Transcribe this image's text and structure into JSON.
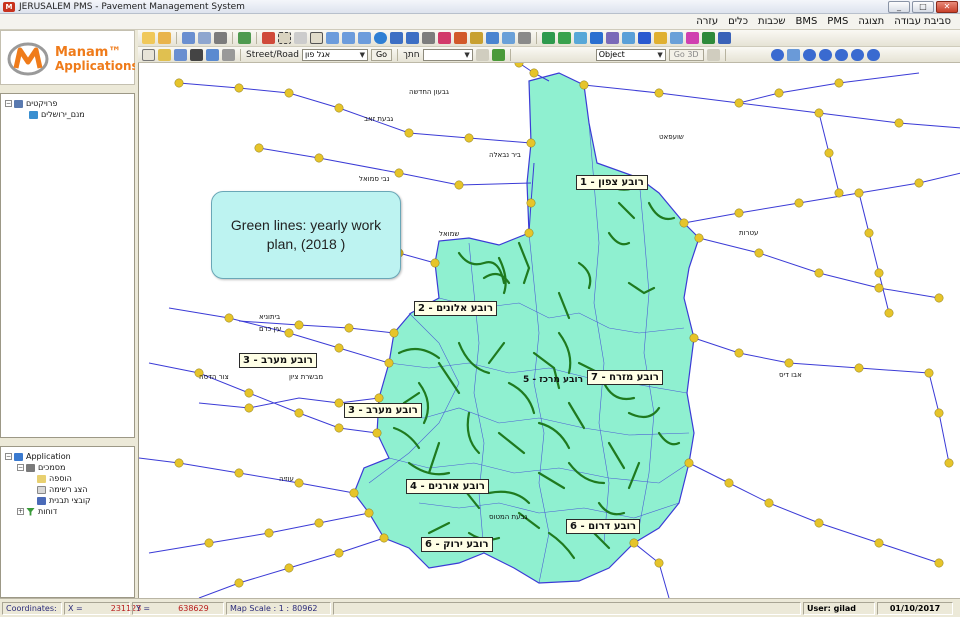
{
  "window": {
    "title": "JERUSALEM PMS - Pavement Management System",
    "app_icon": "pms-app-icon",
    "buttons": [
      "_",
      "□",
      "✕"
    ]
  },
  "menubar": [
    "סביבת עבודה",
    "תצוגה",
    "PMS",
    "BMS",
    "שכבות",
    "כלים",
    "עזרה"
  ],
  "toolbar2": {
    "street_road_label": "Street/Road",
    "street_value": "אגל פון",
    "go_label": "Go",
    "search_label": "חתך",
    "object_label": "Object",
    "go3d_label": "Go 3D"
  },
  "logo": {
    "line1": "Manam™",
    "line2": "Applications"
  },
  "project_tree": {
    "root": "פרויקטים",
    "child": "מנם_ירושלים"
  },
  "app_tree": {
    "root": "Application",
    "items": [
      {
        "label": "מסמכים",
        "indent": 1,
        "icon": "folder-icon"
      },
      {
        "label": "הוספה",
        "indent": 2,
        "icon": "add-doc-icon"
      },
      {
        "label": "הצג רשימה",
        "indent": 2,
        "icon": "list-icon"
      },
      {
        "label": "קובצי תבנית",
        "indent": 2,
        "icon": "template-icon"
      },
      {
        "label": "דוחות",
        "indent": 1,
        "icon": "filter-icon"
      }
    ]
  },
  "map": {
    "callout": "Green lines: yearly work plan, (2018 )",
    "regions": [
      {
        "label": "רובע צפון - 1"
      },
      {
        "label": "רובע אלונים - 2"
      },
      {
        "label": "רובע מערב - 3"
      },
      {
        "label": "רובע מערב - 3"
      },
      {
        "label": "רובע מזרח - 7"
      },
      {
        "label": "רובע מרכז - 5"
      },
      {
        "label": "רובע אורנים - 4"
      },
      {
        "label": "רובע דרום - 6"
      },
      {
        "label": "רובע ירוק - 6"
      }
    ],
    "places": [
      "גבעת זאב",
      "גבעון החדשה",
      "ביר נבאלה",
      "שמואל",
      "נבי סמואל",
      "ביתוניא",
      "עין כרם",
      "עטרות",
      "שועפאט",
      "אבו דיס",
      "מבשרת ציון",
      "צור הדסה",
      "גבעת המטוס",
      "עוזיה"
    ]
  },
  "statusbar": {
    "coordinates_label": "Coordinates:",
    "x_label": "X =",
    "x_value": "231123",
    "y_label": "Y =",
    "y_value": "638629",
    "scale_label": "Map Scale : 1 :",
    "scale_value": "80962",
    "user_label": "User: gilad",
    "date": "01/10/2017"
  },
  "colors": {
    "region_fill": "#8ff0d0",
    "road_blue": "#3b3bd6",
    "work_plan_green": "#1f7a1f",
    "node_yellow": "#e6c42a",
    "label_bg": "#ffffe6",
    "callout_bg": "#bdf3f1"
  }
}
